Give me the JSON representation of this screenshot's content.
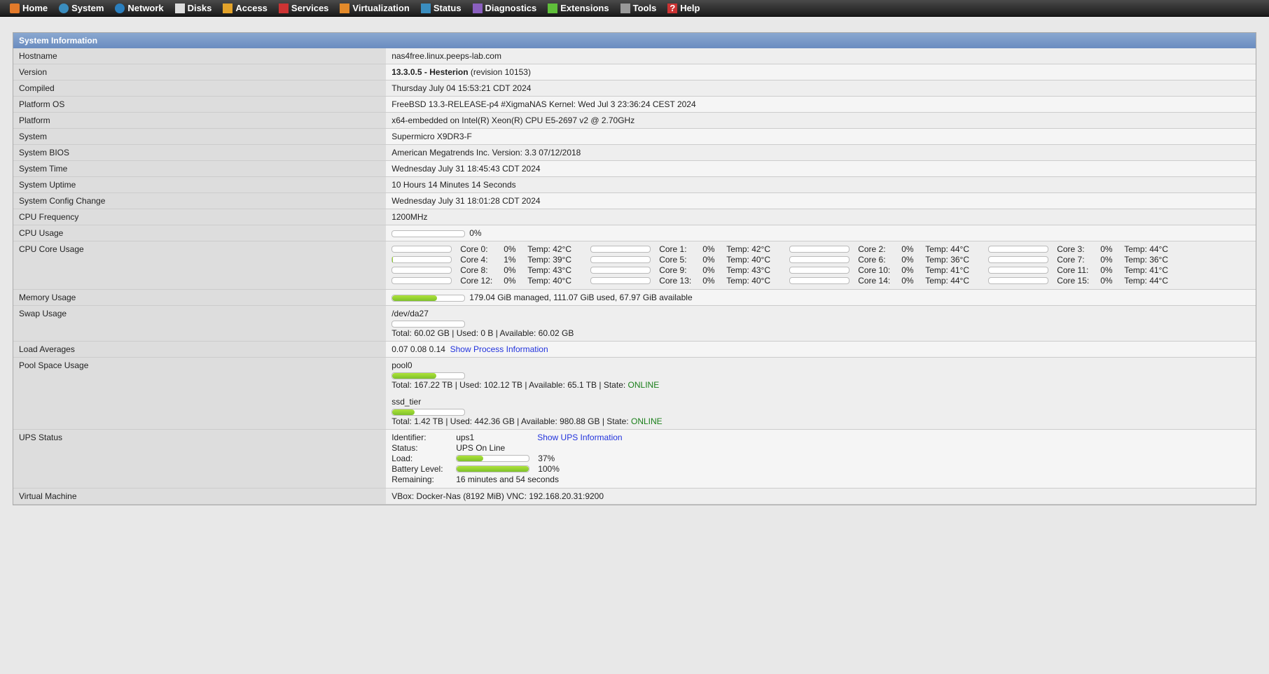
{
  "nav": [
    {
      "label": "Home",
      "icon": "home-icon"
    },
    {
      "label": "System",
      "icon": "system-icon"
    },
    {
      "label": "Network",
      "icon": "network-icon"
    },
    {
      "label": "Disks",
      "icon": "disks-icon"
    },
    {
      "label": "Access",
      "icon": "access-icon"
    },
    {
      "label": "Services",
      "icon": "services-icon"
    },
    {
      "label": "Virtualization",
      "icon": "virtualization-icon"
    },
    {
      "label": "Status",
      "icon": "status-icon"
    },
    {
      "label": "Diagnostics",
      "icon": "diagnostics-icon"
    },
    {
      "label": "Extensions",
      "icon": "extensions-icon"
    },
    {
      "label": "Tools",
      "icon": "tools-icon"
    },
    {
      "label": "Help",
      "icon": "help-icon"
    }
  ],
  "panel": {
    "title": "System Information"
  },
  "rows": {
    "hostname": {
      "label": "Hostname",
      "value": "nas4free.linux.peeps-lab.com"
    },
    "version": {
      "label": "Version",
      "bold": "13.3.0.5 - Hesterion",
      "rest": " (revision 10153)"
    },
    "compiled": {
      "label": "Compiled",
      "value": "Thursday July 04 15:53:21 CDT 2024"
    },
    "platform_os": {
      "label": "Platform OS",
      "value": "FreeBSD 13.3-RELEASE-p4 #XigmaNAS Kernel: Wed Jul 3 23:36:24 CEST 2024"
    },
    "platform": {
      "label": "Platform",
      "value": "x64-embedded on Intel(R) Xeon(R) CPU E5-2697 v2 @ 2.70GHz"
    },
    "system": {
      "label": "System",
      "value": "Supermicro X9DR3-F"
    },
    "bios": {
      "label": "System BIOS",
      "value": "American Megatrends Inc. Version: 3.3 07/12/2018"
    },
    "time": {
      "label": "System Time",
      "value": "Wednesday July 31 18:45:43 CDT 2024"
    },
    "uptime": {
      "label": "System Uptime",
      "value": "10 Hours 14 Minutes 14 Seconds"
    },
    "config": {
      "label": "System Config Change",
      "value": "Wednesday July 31 18:01:28 CDT 2024"
    },
    "freq": {
      "label": "CPU Frequency",
      "value": "1200MHz"
    },
    "cpu_usage": {
      "label": "CPU Usage",
      "pct": 0,
      "text": "0%"
    },
    "core_usage": {
      "label": "CPU Core Usage"
    },
    "memory": {
      "label": "Memory Usage",
      "pct": 62,
      "text": "179.04 GiB managed, 111.07 GiB used, 67.97 GiB available"
    },
    "swap": {
      "label": "Swap Usage",
      "dev": "/dev/da27",
      "pct": 0,
      "text": "Total: 60.02 GB | Used: 0 B | Available: 60.02 GB"
    },
    "load": {
      "label": "Load Averages",
      "text": "0.07 0.08 0.14",
      "link": "Show Process Information"
    },
    "pool": {
      "label": "Pool Space Usage"
    },
    "ups": {
      "label": "UPS Status",
      "link": "Show UPS Information",
      "identifier_lbl": "Identifier:",
      "identifier": "ups1",
      "status_lbl": "Status:",
      "status": "UPS On Line",
      "load_lbl": "Load:",
      "load_pct": 37,
      "load_text": "37%",
      "batt_lbl": "Battery Level:",
      "batt_pct": 100,
      "batt_text": "100%",
      "rem_lbl": "Remaining:",
      "rem": "16 minutes and 54 seconds"
    },
    "vm": {
      "label": "Virtual Machine",
      "value": "VBox: Docker-Nas (8192 MiB) VNC: 192.168.20.31:9200"
    }
  },
  "cores": [
    {
      "n": 0,
      "pct": 0,
      "temp": "42°C"
    },
    {
      "n": 1,
      "pct": 0,
      "temp": "42°C"
    },
    {
      "n": 2,
      "pct": 0,
      "temp": "44°C"
    },
    {
      "n": 3,
      "pct": 0,
      "temp": "44°C"
    },
    {
      "n": 4,
      "pct": 1,
      "temp": "39°C"
    },
    {
      "n": 5,
      "pct": 0,
      "temp": "40°C"
    },
    {
      "n": 6,
      "pct": 0,
      "temp": "36°C"
    },
    {
      "n": 7,
      "pct": 0,
      "temp": "36°C"
    },
    {
      "n": 8,
      "pct": 0,
      "temp": "43°C"
    },
    {
      "n": 9,
      "pct": 0,
      "temp": "43°C"
    },
    {
      "n": 10,
      "pct": 0,
      "temp": "41°C"
    },
    {
      "n": 11,
      "pct": 0,
      "temp": "41°C"
    },
    {
      "n": 12,
      "pct": 0,
      "temp": "40°C"
    },
    {
      "n": 13,
      "pct": 0,
      "temp": "40°C"
    },
    {
      "n": 14,
      "pct": 0,
      "temp": "44°C"
    },
    {
      "n": 15,
      "pct": 0,
      "temp": "44°C"
    }
  ],
  "pools": [
    {
      "name": "pool0",
      "pct": 61,
      "text": "Total: 167.22 TB | Used: 102.12 TB | Available: 65.1 TB | State: ",
      "state": "ONLINE"
    },
    {
      "name": "ssd_tier",
      "pct": 31,
      "text": "Total: 1.42 TB | Used: 442.36 GB | Available: 980.88 GB | State: ",
      "state": "ONLINE"
    }
  ]
}
